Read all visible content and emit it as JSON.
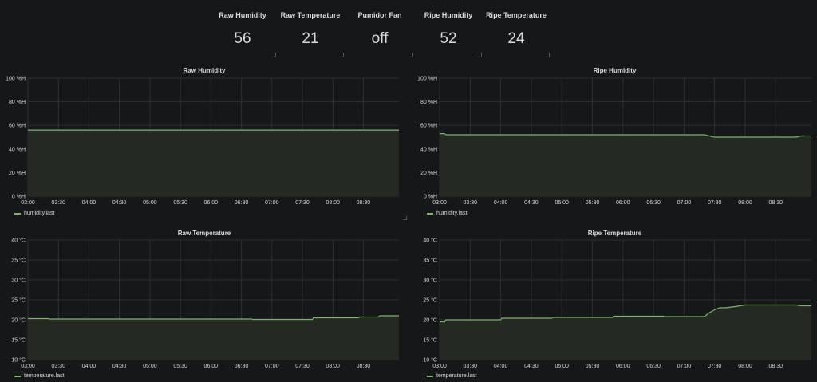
{
  "stats": [
    {
      "title": "Raw Humidity",
      "value": "56"
    },
    {
      "title": "Raw Temperature",
      "value": "21"
    },
    {
      "title": "Pumidor Fan",
      "value": "off"
    },
    {
      "title": "Ripe Humidity",
      "value": "52"
    },
    {
      "title": "Ripe Temperature",
      "value": "24"
    }
  ],
  "colors": {
    "series": "#7eb26d",
    "fill": "#242a22",
    "grid": "#2e2f32",
    "background": "#161719"
  },
  "chart_data": [
    {
      "type": "area",
      "title": "Raw Humidity",
      "legend": "humidity.last",
      "xticks": [
        "03:00",
        "03:30",
        "04:00",
        "04:30",
        "05:00",
        "05:30",
        "06:00",
        "06:30",
        "07:00",
        "07:30",
        "08:00",
        "08:30"
      ],
      "yticks": [
        "0 %H",
        "20 %H",
        "40 %H",
        "60 %H",
        "80 %H",
        "100 %H"
      ],
      "ylim": [
        0,
        100
      ],
      "xlim": [
        "03:00",
        "09:05"
      ],
      "x": [
        "03:00",
        "09:05"
      ],
      "y": [
        56,
        56
      ]
    },
    {
      "type": "area",
      "title": "Ripe Humidity",
      "legend": "humidity.last",
      "xticks": [
        "03:00",
        "03:30",
        "04:00",
        "04:30",
        "05:00",
        "05:30",
        "06:00",
        "06:30",
        "07:00",
        "07:30",
        "08:00",
        "08:30"
      ],
      "yticks": [
        "0 %H",
        "20 %H",
        "40 %H",
        "60 %H",
        "80 %H",
        "100 %H"
      ],
      "ylim": [
        0,
        100
      ],
      "xlim": [
        "03:00",
        "09:05"
      ],
      "x": [
        "03:00",
        "03:05",
        "03:06",
        "07:20",
        "07:25",
        "07:30",
        "08:50",
        "08:55",
        "09:05"
      ],
      "y": [
        53,
        53,
        52,
        52,
        51,
        50,
        50,
        51,
        51
      ]
    },
    {
      "type": "area",
      "title": "Raw Temperature",
      "legend": "temperature.last",
      "xticks": [
        "03:00",
        "03:30",
        "04:00",
        "04:30",
        "05:00",
        "05:30",
        "06:00",
        "06:30",
        "07:00",
        "07:30",
        "08:00",
        "08:30"
      ],
      "yticks": [
        "10 °C",
        "15 °C",
        "20 °C",
        "25 °C",
        "30 °C",
        "35 °C",
        "40 °C"
      ],
      "ylim": [
        10,
        40
      ],
      "xlim": [
        "03:00",
        "09:05"
      ],
      "x": [
        "03:00",
        "03:20",
        "03:21",
        "06:40",
        "06:41",
        "07:40",
        "07:41",
        "08:25",
        "08:26",
        "08:45",
        "08:46",
        "09:05"
      ],
      "y": [
        20.3,
        20.3,
        20.2,
        20.2,
        20.1,
        20.1,
        20.5,
        20.5,
        20.7,
        20.7,
        21,
        21
      ]
    },
    {
      "type": "area",
      "title": "Ripe Temperature",
      "legend": "temperature.last",
      "xticks": [
        "03:00",
        "03:30",
        "04:00",
        "04:30",
        "05:00",
        "05:30",
        "06:00",
        "06:30",
        "07:00",
        "07:30",
        "08:00",
        "08:30"
      ],
      "yticks": [
        "10 °C",
        "15 °C",
        "20 °C",
        "25 °C",
        "30 °C",
        "35 °C",
        "40 °C"
      ],
      "ylim": [
        10,
        40
      ],
      "xlim": [
        "03:00",
        "09:05"
      ],
      "x": [
        "03:00",
        "03:05",
        "03:06",
        "03:30",
        "04:00",
        "04:01",
        "04:50",
        "04:51",
        "05:50",
        "05:51",
        "06:40",
        "06:41",
        "07:20",
        "07:25",
        "07:30",
        "07:35",
        "07:40",
        "07:50",
        "08:00",
        "08:10",
        "08:50",
        "08:55",
        "09:05"
      ],
      "y": [
        19.5,
        19.5,
        20,
        20,
        20,
        20.4,
        20.4,
        20.6,
        20.6,
        20.9,
        20.9,
        20.8,
        20.8,
        21.8,
        22.5,
        23,
        23,
        23.3,
        23.7,
        23.7,
        23.7,
        23.5,
        23.5
      ]
    }
  ]
}
